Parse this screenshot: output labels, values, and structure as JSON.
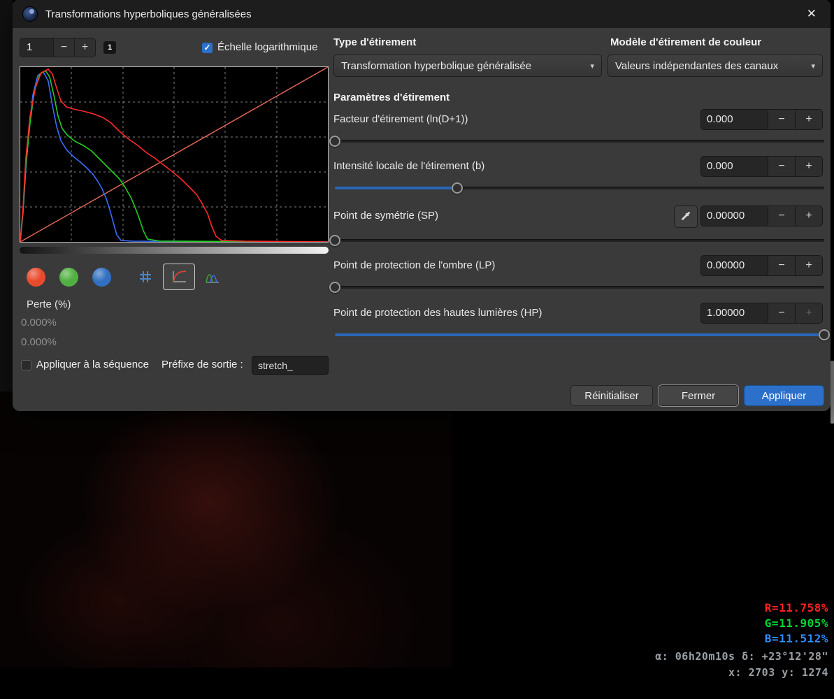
{
  "window": {
    "title": "Transformations hyperboliques généralisées"
  },
  "glyphs": {
    "minus": "−",
    "plus": "+",
    "arrow": "▾",
    "check": "✓",
    "close": "✕"
  },
  "left": {
    "frame_spinner_value": "1",
    "frame_badge": "1",
    "log_checkbox_label": "Échelle logarithmique",
    "loss_label": "Perte (%)",
    "loss_value_1": "0.000%",
    "loss_value_2": "0.000%",
    "sequence_checkbox_label": "Appliquer à la séquence",
    "prefix_label": "Préfixe de sortie :",
    "prefix_value": "stretch_"
  },
  "right": {
    "stretch_type_label": "Type d'étirement",
    "stretch_type_value": "Transformation hyperbolique généralisée",
    "color_model_label": "Modèle d'étirement de couleur",
    "color_model_value": "Valeurs indépendantes des canaux",
    "params_header": "Paramètres d'étirement",
    "params": [
      {
        "label": "Facteur d'étirement (ln(D+1))",
        "value": "0.000",
        "slider_pct": 0
      },
      {
        "label": "Intensité locale de l'étirement (b)",
        "value": "0.000",
        "slider_pct": 25
      },
      {
        "label": "Point de symétrie (SP)",
        "value": "0.00000",
        "slider_pct": 0
      },
      {
        "label": "Point de protection de l'ombre (LP)",
        "value": "0.00000",
        "slider_pct": 0
      },
      {
        "label": "Point de protection des hautes lumières (HP)",
        "value": "1.00000",
        "slider_pct": 100,
        "plus_disabled": true
      }
    ],
    "reset_button": "Réinitialiser",
    "close_button": "Fermer",
    "apply_button": "Appliquer"
  },
  "overlay": {
    "r": "R=11.758%",
    "g": "G=11.905%",
    "b": "B=11.512%",
    "celestial": "α: 06h20m10s δ: +23°12'28\"",
    "pixel": "x: 2703 y: 1274"
  },
  "colors": {
    "accent": "#2d70c9",
    "slider_fill": "#2a66b8",
    "chan_red": "#e84b2c",
    "chan_green": "#52b043",
    "chan_blue": "#3271c2",
    "hist_red": "#ff2a2a",
    "hist_green": "#22cc22",
    "hist_blue": "#3a6cff",
    "readout_red": "#ff2222",
    "readout_green": "#00d535",
    "readout_blue": "#2f8dff"
  },
  "histogram": {
    "red": [
      [
        0,
        250
      ],
      [
        4,
        200
      ],
      [
        8,
        130
      ],
      [
        14,
        70
      ],
      [
        22,
        28
      ],
      [
        30,
        8
      ],
      [
        40,
        3
      ],
      [
        46,
        10
      ],
      [
        52,
        30
      ],
      [
        58,
        48
      ],
      [
        66,
        57
      ],
      [
        76,
        60
      ],
      [
        90,
        63
      ],
      [
        105,
        67
      ],
      [
        118,
        72
      ],
      [
        130,
        80
      ],
      [
        142,
        92
      ],
      [
        155,
        103
      ],
      [
        168,
        112
      ],
      [
        180,
        122
      ],
      [
        192,
        130
      ],
      [
        205,
        140
      ],
      [
        218,
        150
      ],
      [
        230,
        160
      ],
      [
        242,
        172
      ],
      [
        252,
        182
      ],
      [
        260,
        195
      ],
      [
        268,
        210
      ],
      [
        274,
        228
      ],
      [
        280,
        242
      ],
      [
        288,
        248
      ],
      [
        320,
        249
      ],
      [
        440,
        250
      ]
    ],
    "green": [
      [
        0,
        250
      ],
      [
        4,
        205
      ],
      [
        8,
        140
      ],
      [
        14,
        80
      ],
      [
        20,
        35
      ],
      [
        28,
        10
      ],
      [
        36,
        5
      ],
      [
        42,
        14
      ],
      [
        48,
        40
      ],
      [
        54,
        70
      ],
      [
        60,
        88
      ],
      [
        68,
        98
      ],
      [
        78,
        106
      ],
      [
        90,
        112
      ],
      [
        102,
        120
      ],
      [
        112,
        130
      ],
      [
        122,
        140
      ],
      [
        132,
        150
      ],
      [
        142,
        160
      ],
      [
        150,
        172
      ],
      [
        158,
        186
      ],
      [
        164,
        200
      ],
      [
        170,
        216
      ],
      [
        176,
        234
      ],
      [
        182,
        246
      ],
      [
        200,
        249
      ],
      [
        440,
        250
      ]
    ],
    "blue": [
      [
        0,
        250
      ],
      [
        4,
        208
      ],
      [
        8,
        145
      ],
      [
        13,
        85
      ],
      [
        18,
        40
      ],
      [
        25,
        12
      ],
      [
        33,
        7
      ],
      [
        40,
        20
      ],
      [
        46,
        55
      ],
      [
        52,
        85
      ],
      [
        58,
        105
      ],
      [
        66,
        118
      ],
      [
        76,
        128
      ],
      [
        86,
        136
      ],
      [
        95,
        144
      ],
      [
        103,
        152
      ],
      [
        110,
        162
      ],
      [
        117,
        174
      ],
      [
        123,
        188
      ],
      [
        128,
        204
      ],
      [
        133,
        222
      ],
      [
        138,
        240
      ],
      [
        144,
        248
      ],
      [
        160,
        249
      ],
      [
        440,
        250
      ]
    ]
  }
}
